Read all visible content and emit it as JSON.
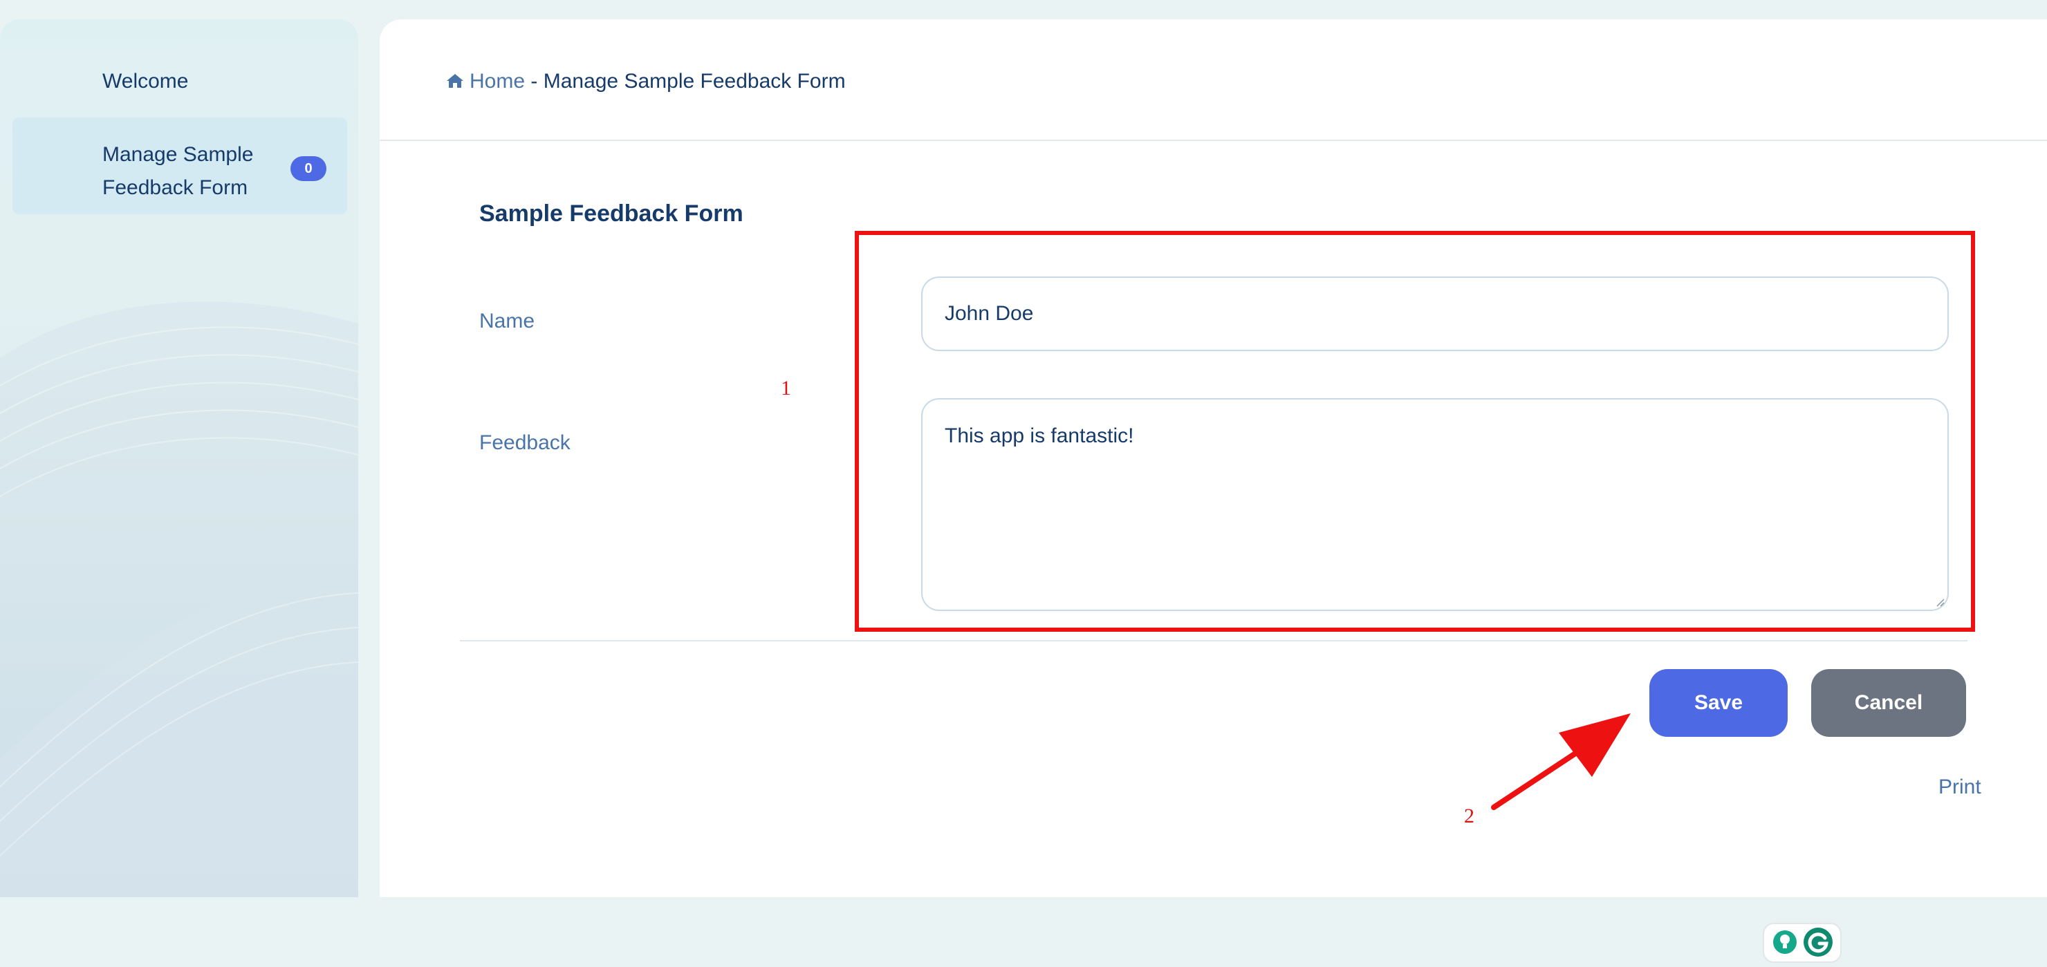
{
  "sidebar": {
    "items": [
      {
        "label": "Welcome"
      },
      {
        "label_line1": "Manage Sample",
        "label_line2": "Feedback Form",
        "badge": "0"
      }
    ]
  },
  "breadcrumb": {
    "home": "Home",
    "separator": " - ",
    "current": "Manage Sample Feedback Form",
    "home_icon": "home-icon"
  },
  "form": {
    "title": "Sample Feedback Form",
    "name_label": "Name",
    "name_value": "John Doe",
    "feedback_label": "Feedback",
    "feedback_value": "This app is fantastic!"
  },
  "actions": {
    "save": "Save",
    "cancel": "Cancel",
    "print": "Print"
  },
  "annotations": {
    "box_label": "1",
    "arrow_label": "2",
    "color": "#ee1111"
  },
  "colors": {
    "primary": "#4e69e4",
    "secondary": "#6b7480",
    "text": "#163b6b",
    "link": "#4a74a8"
  }
}
